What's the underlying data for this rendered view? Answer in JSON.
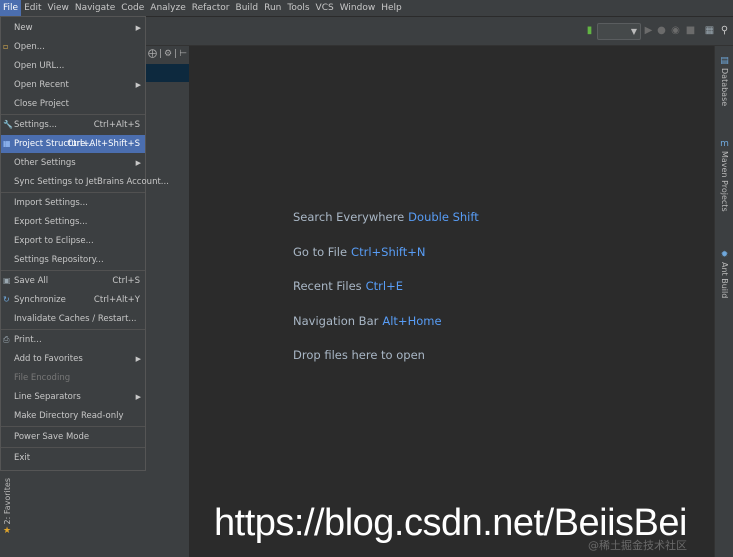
{
  "menubar": {
    "items": [
      "File",
      "Edit",
      "View",
      "Navigate",
      "Code",
      "Analyze",
      "Refactor",
      "Build",
      "Run",
      "Tools",
      "VCS",
      "Window",
      "Help"
    ]
  },
  "file_menu": {
    "items": [
      {
        "label": "New",
        "shortcut": "",
        "submenu": true,
        "icon": "",
        "state": "normal"
      },
      {
        "label": "Open...",
        "shortcut": "",
        "submenu": false,
        "icon": "folder-icon",
        "state": "normal"
      },
      {
        "label": "Open URL...",
        "shortcut": "",
        "submenu": false,
        "icon": "",
        "state": "normal"
      },
      {
        "label": "Open Recent",
        "shortcut": "",
        "submenu": true,
        "icon": "",
        "state": "normal"
      },
      {
        "label": "Close Project",
        "shortcut": "",
        "submenu": false,
        "icon": "",
        "state": "normal"
      },
      {
        "label": "Settings...",
        "shortcut": "Ctrl+Alt+S",
        "submenu": false,
        "icon": "wrench-icon",
        "state": "normal"
      },
      {
        "label": "Project Structure...",
        "shortcut": "Ctrl+Alt+Shift+S",
        "submenu": false,
        "icon": "project-structure-icon",
        "state": "selected"
      },
      {
        "label": "Other Settings",
        "shortcut": "",
        "submenu": true,
        "icon": "",
        "state": "normal"
      },
      {
        "label": "Sync Settings to JetBrains Account...",
        "shortcut": "",
        "submenu": false,
        "icon": "",
        "state": "normal"
      },
      {
        "label": "Import Settings...",
        "shortcut": "",
        "submenu": false,
        "icon": "",
        "state": "normal"
      },
      {
        "label": "Export Settings...",
        "shortcut": "",
        "submenu": false,
        "icon": "",
        "state": "normal"
      },
      {
        "label": "Export to Eclipse...",
        "shortcut": "",
        "submenu": false,
        "icon": "",
        "state": "normal"
      },
      {
        "label": "Settings Repository...",
        "shortcut": "",
        "submenu": false,
        "icon": "",
        "state": "normal"
      },
      {
        "label": "Save All",
        "shortcut": "Ctrl+S",
        "submenu": false,
        "icon": "save-icon",
        "state": "normal"
      },
      {
        "label": "Synchronize",
        "shortcut": "Ctrl+Alt+Y",
        "submenu": false,
        "icon": "sync-icon",
        "state": "normal"
      },
      {
        "label": "Invalidate Caches / Restart...",
        "shortcut": "",
        "submenu": false,
        "icon": "",
        "state": "normal"
      },
      {
        "label": "Print...",
        "shortcut": "",
        "submenu": false,
        "icon": "print-icon",
        "state": "normal"
      },
      {
        "label": "Add to Favorites",
        "shortcut": "",
        "submenu": true,
        "icon": "",
        "state": "normal"
      },
      {
        "label": "File Encoding",
        "shortcut": "",
        "submenu": false,
        "icon": "",
        "state": "disabled"
      },
      {
        "label": "Line Separators",
        "shortcut": "",
        "submenu": true,
        "icon": "",
        "state": "normal"
      },
      {
        "label": "Make Directory Read-only",
        "shortcut": "",
        "submenu": false,
        "icon": "",
        "state": "normal"
      },
      {
        "label": "Power Save Mode",
        "shortcut": "",
        "submenu": false,
        "icon": "",
        "state": "normal"
      },
      {
        "label": "Exit",
        "shortcut": "",
        "submenu": false,
        "icon": "",
        "state": "normal"
      }
    ]
  },
  "editor": {
    "hints": [
      {
        "label": "Search Everywhere",
        "key": "Double Shift"
      },
      {
        "label": "Go to File",
        "key": "Ctrl+Shift+N"
      },
      {
        "label": "Recent Files",
        "key": "Ctrl+E"
      },
      {
        "label": "Navigation Bar",
        "key": "Alt+Home"
      },
      {
        "label": "Drop files here to open",
        "key": ""
      }
    ]
  },
  "right_tabs": {
    "database": "Database",
    "maven": "Maven Projects",
    "ant": "Ant Build"
  },
  "left_tabs": {
    "favorites": "2: Favorites"
  },
  "watermark": {
    "url": "https://blog.csdn.net/BeiisBei",
    "small": "@稀土掘金技术社区"
  },
  "colors": {
    "accent": "#4b6eaf",
    "shortcut_blue": "#589df6",
    "editor_bg": "#2b2b2b",
    "panel_bg": "#3c3f41"
  }
}
